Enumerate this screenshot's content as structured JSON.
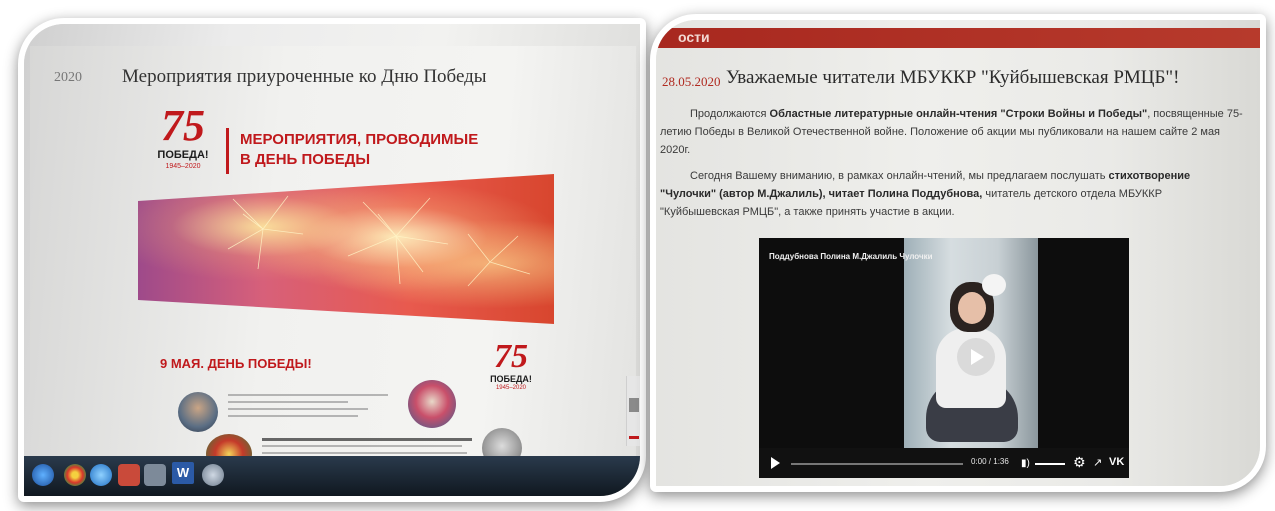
{
  "left_photo": {
    "page": {
      "date": "2020",
      "title": "Мероприятия приуроченные ко Дню Победы",
      "logo_top": {
        "number": "75",
        "word": "ПОБЕДА!",
        "years": "1945–2020"
      },
      "heading_line1": "МЕРОПРИЯТИЯ, ПРОВОДИМЫЕ",
      "heading_line2": "В ДЕНЬ ПОБЕДЫ",
      "subheading": "9 МАЯ. ДЕНЬ ПОБЕДЫ!",
      "logo_bottom": {
        "number": "75",
        "word": "ПОБЕДА!",
        "years": "1945–2020"
      }
    },
    "taskbar": {
      "word_button": "W"
    }
  },
  "right_photo": {
    "page": {
      "section": "ости",
      "date": "28.05.2020",
      "title": "Уважаемые читатели МБУККР \"Куйбышевская РМЦБ\"!",
      "p1_line1_start": "Продолжаются ",
      "p1_line1_bold": "Областные литературные онлайн-чтения \"Строки Войны и Победы\"",
      "p1_line1_end": ", посвященные 75-",
      "p1_line2": "летию Победы в Великой Отечественной войне. Положение об акции  мы публиковали  на нашем сайте 2 мая",
      "p1_line3": "2020г.",
      "p2_line1_start": "Сегодня Вашему вниманию, в рамках онлайн-чтений,  мы предлагаем послушать ",
      "p2_line1_bold": "стихотворение",
      "p2_line2_bold": "\"Чулочки\"  (автор М.Джалиль), читает Полина Поддубнова,",
      "p2_line2_end": " читатель детского отдела МБУККР",
      "p2_line3": "\"Куйбышевская РМЦБ\", а также принять участие в акции."
    },
    "video": {
      "title": "Поддубнова Полина М.Джалиль Чулочки",
      "time": "0:00 / 1:36",
      "logo": "VK"
    }
  }
}
